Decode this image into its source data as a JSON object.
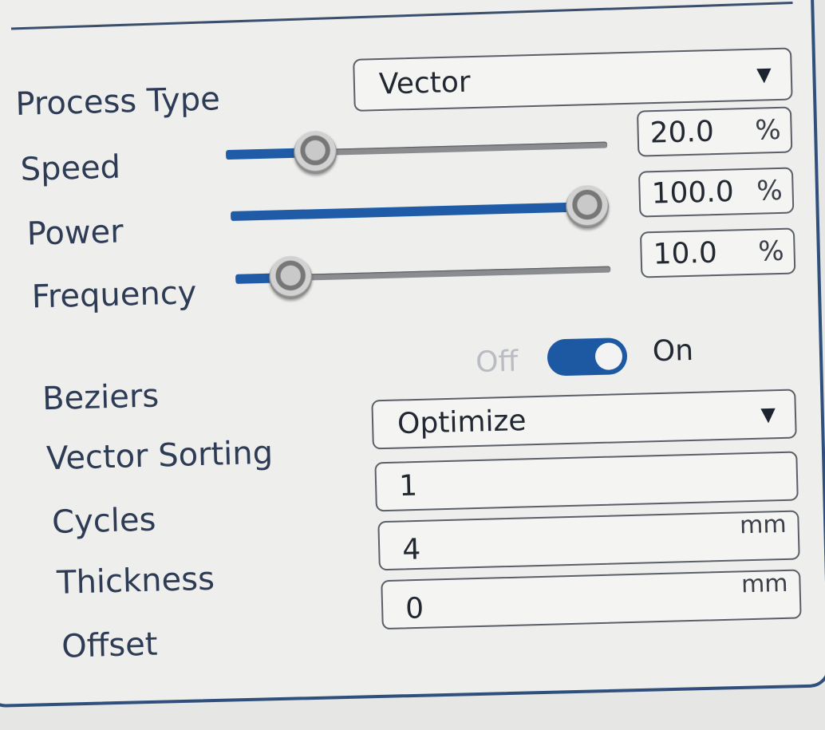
{
  "labels": {
    "process_type": "Process Type",
    "speed": "Speed",
    "power": "Power",
    "frequency": "Frequency",
    "beziers": "Beziers",
    "vector_sorting": "Vector Sorting",
    "cycles": "Cycles",
    "thickness": "Thickness",
    "offset": "Offset"
  },
  "process_type": {
    "value": "Vector",
    "arrow": "▼"
  },
  "speed": {
    "value": "20.0",
    "unit": "%",
    "level": 0.2
  },
  "power": {
    "value": "100.0",
    "unit": "%",
    "level": 1.0
  },
  "frequency": {
    "value": "10.0",
    "unit": "%",
    "level": 0.1
  },
  "beziers": {
    "off_label": "Off",
    "on_label": "On",
    "state": "on"
  },
  "vector_sorting": {
    "value": "Optimize",
    "arrow": "▼"
  },
  "cycles": {
    "value": "1"
  },
  "thickness": {
    "value": "4",
    "unit": "mm"
  },
  "offset": {
    "value": "0",
    "unit": "mm"
  },
  "colors": {
    "accent": "#1f5ba6",
    "label": "#2d3b55",
    "panel_border": "#2f4f7c"
  }
}
